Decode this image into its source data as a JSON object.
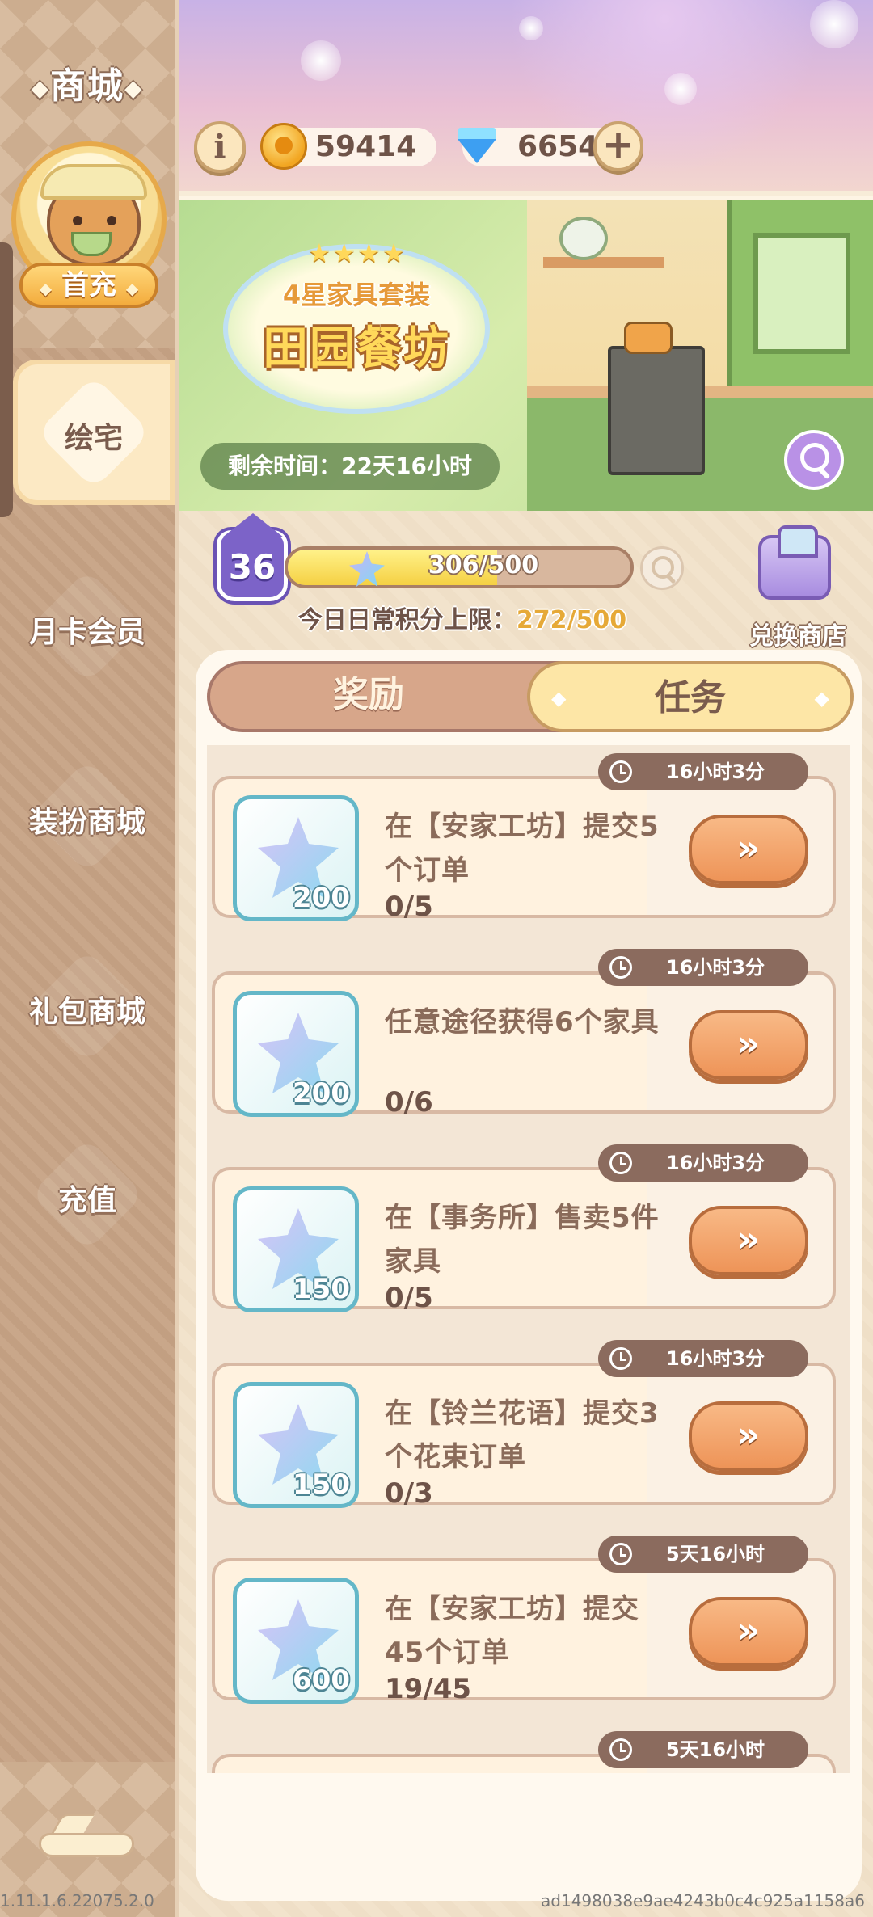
{
  "sidebar": {
    "title": "商城",
    "first_charge_label": "首充",
    "items": [
      {
        "label": "绘宅",
        "active": true
      },
      {
        "label": "月卡会员",
        "active": false
      },
      {
        "label": "装扮商城",
        "active": false
      },
      {
        "label": "礼包商城",
        "active": false
      },
      {
        "label": "充值",
        "active": false
      }
    ]
  },
  "currencies": {
    "coins": "59414",
    "gems": "6654"
  },
  "banner": {
    "stars": "★★★★",
    "subtitle": "4星家具套装",
    "title": "田园餐坊",
    "timer": "剩余时间：22天16小时"
  },
  "progress": {
    "level": "36",
    "current": 306,
    "max": 500,
    "text": "306/500",
    "daily_limit_label": "今日日常积分上限：",
    "daily_limit_value": "272/500",
    "exchange_shop": "兑换商店"
  },
  "tabs": {
    "rewards": "奖励",
    "tasks": "任务",
    "active": "tasks"
  },
  "tasks": [
    {
      "time": "16小时3分",
      "reward": "200",
      "desc": "在【安家工坊】提交5个订单",
      "progress": "0/5",
      "button": "»"
    },
    {
      "time": "16小时3分",
      "reward": "200",
      "desc": "任意途径获得6个家具",
      "progress": "0/6",
      "button": "»"
    },
    {
      "time": "16小时3分",
      "reward": "150",
      "desc": "在【事务所】售卖5件家具",
      "progress": "0/5",
      "button": "»"
    },
    {
      "time": "16小时3分",
      "reward": "150",
      "desc": "在【铃兰花语】提交3个花束订单",
      "progress": "0/3",
      "button": "»"
    },
    {
      "time": "5天16小时",
      "reward": "600",
      "desc": "在【安家工坊】提交45个订单",
      "progress": "19/45",
      "button": "»"
    },
    {
      "time": "5天16小时"
    }
  ],
  "footer": {
    "version": "1.11.1.6.22075.2.0",
    "build_id": "ad1498038e9ae4243b0c4c925a1158a6"
  },
  "colors": {
    "accent_orange": "#ee9458",
    "sidebar_bg": "#c6a284",
    "tab_active_bg": "#fde6a6"
  }
}
